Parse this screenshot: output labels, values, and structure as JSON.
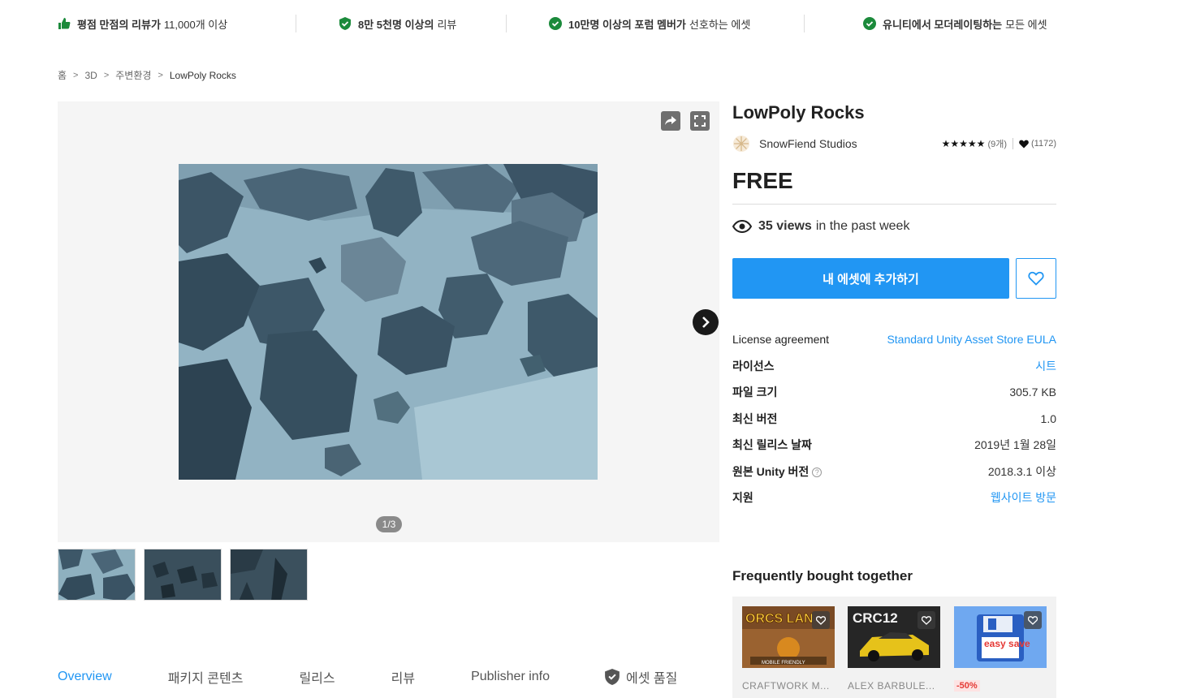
{
  "trust_bar": [
    {
      "bold": "평점 만점의 리뷰가",
      "rest": "11,000개 이상",
      "icon": "thumbs-up-icon"
    },
    {
      "bold": "8만 5천명 이상의",
      "rest": "리뷰",
      "icon": "shield-check-icon"
    },
    {
      "bold": "10만명 이상의 포럼 멤버가",
      "rest": "선호하는 에셋",
      "icon": "check-circle-icon"
    },
    {
      "bold": "유니티에서 모더레이팅하는",
      "rest": "모든 에셋",
      "icon": "check-circle-icon"
    }
  ],
  "breadcrumb": [
    "홈",
    "3D",
    "주변환경",
    "LowPoly Rocks"
  ],
  "gallery": {
    "counter": "1/3",
    "current_index": 1,
    "total": 3
  },
  "product": {
    "title": "LowPoly Rocks",
    "publisher": "SnowFiend Studios",
    "rating_stars": "★★★★★",
    "rating_count": "(9개)",
    "favorites_count": "(1172)",
    "price": "FREE",
    "views_bold": "35 views",
    "views_rest": "in the past week",
    "add_button": "내 에셋에 추가하기"
  },
  "details": [
    {
      "key": "License agreement",
      "value": "Standard Unity Asset Store EULA",
      "link": true,
      "plain": true
    },
    {
      "key": "라이선스",
      "value": "시트",
      "link": true
    },
    {
      "key": "파일 크기",
      "value": "305.7 KB",
      "link": false
    },
    {
      "key": "최신 버전",
      "value": "1.0",
      "link": false
    },
    {
      "key": "최신 릴리스 날짜",
      "value": "2019년 1월 28일",
      "link": false
    },
    {
      "key": "원본 Unity 버전",
      "value": "2018.3.1 이상",
      "link": false,
      "help": "?"
    },
    {
      "key": "지원",
      "value": "웹사이트 방문",
      "link": true
    }
  ],
  "tabs": [
    "Overview",
    "패키지 콘텐츠",
    "릴리스",
    "리뷰",
    "Publisher info",
    "에셋 품질"
  ],
  "fbt": {
    "title": "Frequently bought together",
    "items": [
      {
        "publisher": "CRAFTWORK M...",
        "image_text": "ORCS LAN",
        "badge_text": "MOBILE FRIENDLY"
      },
      {
        "publisher": "ALEX BARBULE...",
        "image_text": "CRC12"
      },
      {
        "sale": "-50%",
        "image_text": "easy save"
      }
    ]
  },
  "colors": {
    "accent": "#2196f3",
    "trust_green": "#1b8a3b",
    "sale_red": "#e53935"
  }
}
